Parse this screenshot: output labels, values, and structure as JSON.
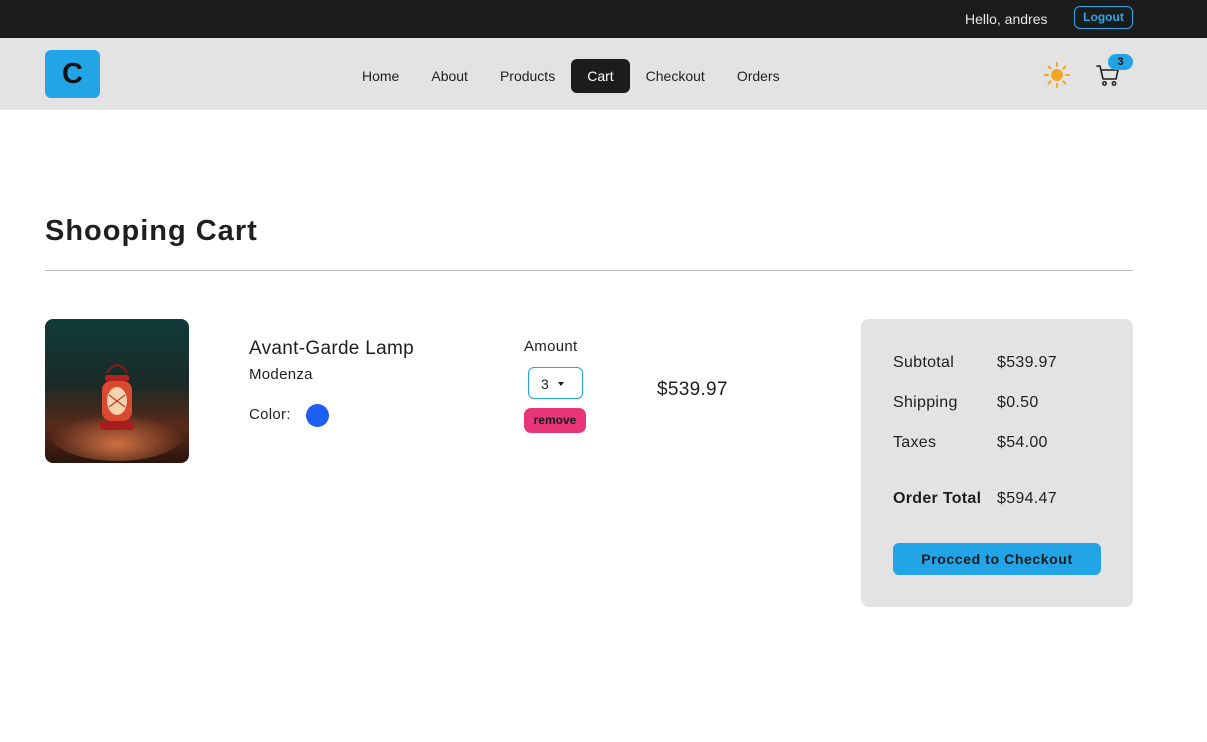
{
  "topbar": {
    "greeting": "Hello, andres",
    "logout_label": "Logout"
  },
  "navbar": {
    "logo_letter": "C",
    "links": [
      "Home",
      "About",
      "Products",
      "Cart",
      "Checkout",
      "Orders"
    ],
    "active_link": "Cart",
    "theme_icon": "sun-icon",
    "cart_icon": "cart-icon",
    "cart_count": "3"
  },
  "page": {
    "title": "Shooping Cart"
  },
  "cart_item": {
    "name": "Avant-Garde Lamp",
    "company": "Modenza",
    "color_label": "Color:",
    "color": "#1f5ef0",
    "amount_label": "Amount",
    "amount_value": "3",
    "remove_label": "remove",
    "price": "$539.97"
  },
  "totals": {
    "subtotal_label": "Subtotal",
    "subtotal_value": "$539.97",
    "shipping_label": "Shipping",
    "shipping_value": "$0.50",
    "taxes_label": "Taxes",
    "taxes_value": "$54.00",
    "order_total_label": "Order Total",
    "order_total_value": "$594.47",
    "checkout_label": "Procced to Checkout"
  },
  "colors": {
    "accent": "#23a4e6",
    "danger": "#e8357a",
    "dark": "#1c1c1c",
    "panel": "#e3e3e3"
  }
}
